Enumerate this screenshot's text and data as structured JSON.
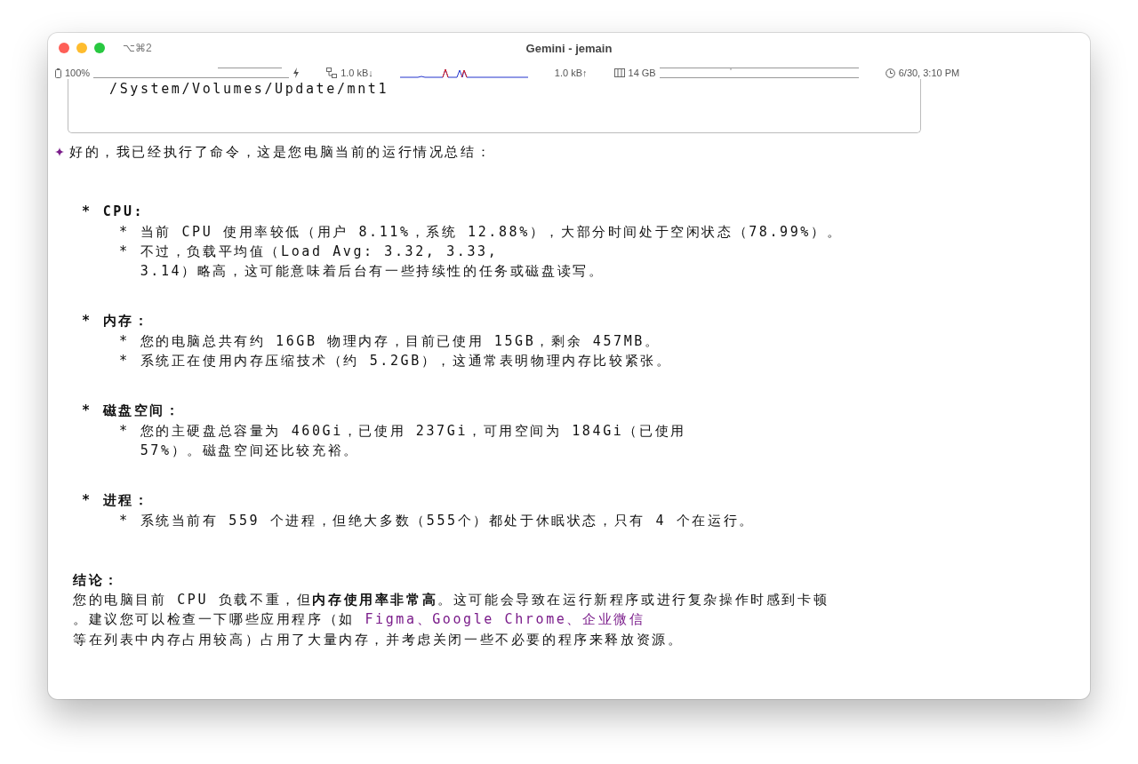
{
  "window": {
    "title": "Gemini - jemain",
    "shortcut": "⌥⌘2"
  },
  "status_bar": {
    "battery": "100%",
    "download": "1.0 kB↓",
    "upload": "1.0 kB↑",
    "memory": "14 GB",
    "clock": "6/30, 3:10 PM"
  },
  "output_box": {
    "lines": [
      "/System/Volumes/Update/mnt1"
    ]
  },
  "response": {
    "intro": "好的，我已经执行了命令，这是您电脑当前的运行情况总结：",
    "sections": [
      {
        "marker": "*",
        "heading": "CPU:",
        "items": [
          {
            "marker": "*",
            "lines": [
              "当前 CPU 使用率较低（用户 8.11%，系统 12.88%），大部分时间处于空闲状态（78.99%）。"
            ]
          },
          {
            "marker": "*",
            "lines": [
              "不过，负载平均值（Load Avg: 3.32, 3.33,",
              "3.14）略高，这可能意味着后台有一些持续性的任务或磁盘读写。"
            ]
          }
        ]
      },
      {
        "marker": "*",
        "heading": "内存：",
        "items": [
          {
            "marker": "*",
            "lines": [
              "您的电脑总共有约 16GB 物理内存，目前已使用 15GB，剩余 457MB。"
            ]
          },
          {
            "marker": "*",
            "lines": [
              "系统正在使用内存压缩技术（约 5.2GB），这通常表明物理内存比较紧张。"
            ]
          }
        ]
      },
      {
        "marker": "*",
        "heading": "磁盘空间：",
        "items": [
          {
            "marker": "*",
            "lines": [
              "您的主硬盘总容量为 460Gi，已使用 237Gi，可用空间为 184Gi（已使用",
              "57%）。磁盘空间还比较充裕。"
            ]
          }
        ]
      },
      {
        "marker": "*",
        "heading": "进程：",
        "items": [
          {
            "marker": "*",
            "lines": [
              "系统当前有 559 个进程，但绝大多数（555个）都处于休眠状态，只有 4 个在运行。"
            ]
          }
        ]
      }
    ],
    "conclusion": {
      "heading": "结论：",
      "lines": [
        [
          {
            "kind": "text",
            "text": "您的电脑目前 CPU 负载不重，但**内存使用率非常高**。这可能会导致在运行新程序或进行复杂操作时感到卡顿"
          }
        ],
        [
          {
            "kind": "text",
            "text": "。建议您可以检查一下哪些应用程序（如 "
          },
          {
            "kind": "link",
            "text": "Figma、Google Chrome、企业微信"
          }
        ],
        [
          {
            "kind": "text",
            "text": "等在列表中内存占用较高）占用了大量内存，并考虑关闭一些不必要的程序来释放资源。"
          }
        ]
      ]
    }
  }
}
